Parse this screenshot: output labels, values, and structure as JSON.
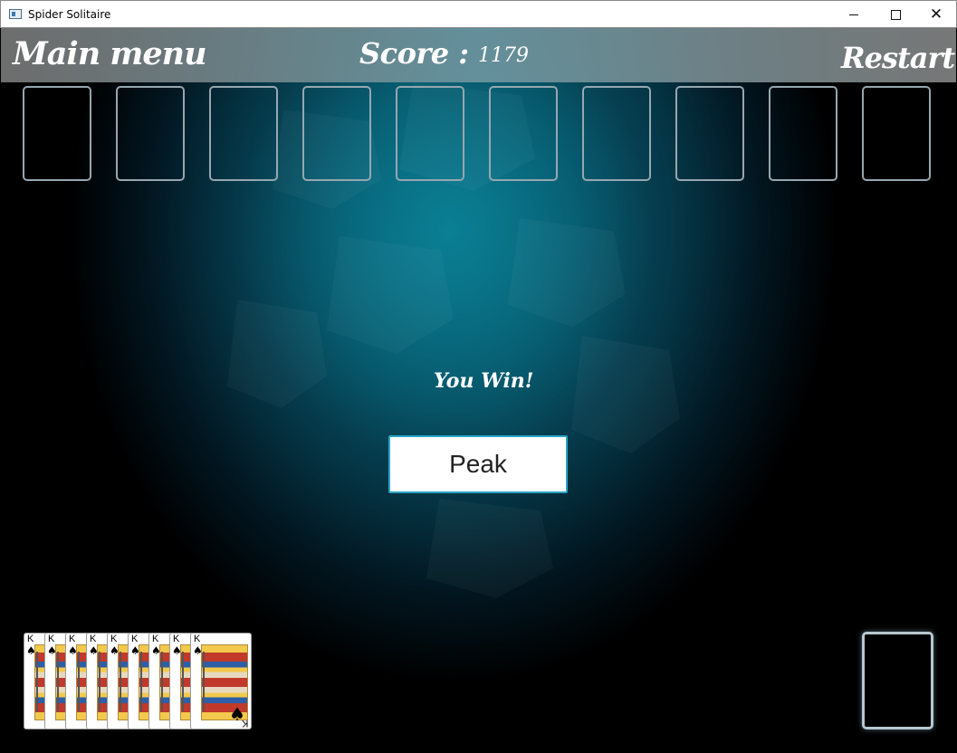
{
  "window": {
    "title": "Spider Solitaire",
    "close_glyph": "✕"
  },
  "header": {
    "main_menu_label": "Main menu",
    "score_label": "Score :",
    "score_value": "1179",
    "restart_label": "Restart"
  },
  "foundation_slots": 10,
  "message": {
    "win_text": "You Win!",
    "peak_button_label": "Peak"
  },
  "completed_stack": {
    "rank": "K",
    "suit_symbol": "♠",
    "card_count": 9
  },
  "colors": {
    "background_center": "#0b6f86",
    "background_edge": "#000000",
    "header_bar": "#7a8f94",
    "slot_border": "#96a7b0",
    "button_border": "#2aa6c7"
  }
}
